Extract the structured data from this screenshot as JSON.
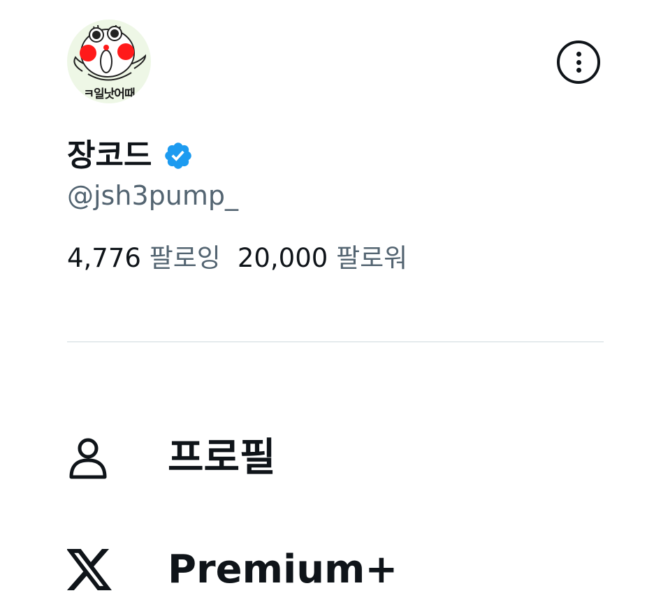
{
  "profile": {
    "avatar_text": "ㅋ일낫어때",
    "display_name": "장코드",
    "handle": "@jsh3pump_",
    "verified": true,
    "verified_color": "#1d9bf0"
  },
  "stats": {
    "following_count": "4,776",
    "following_label": "팔로잉",
    "followers_count": "20,000",
    "followers_label": "팔로워"
  },
  "menu": {
    "items": [
      {
        "label": "프로필",
        "icon": "person-icon"
      },
      {
        "label": "Premium+",
        "icon": "x-logo-icon"
      }
    ]
  },
  "colors": {
    "text_primary": "#0f1419",
    "text_secondary": "#536471",
    "divider": "#cfd9de"
  }
}
